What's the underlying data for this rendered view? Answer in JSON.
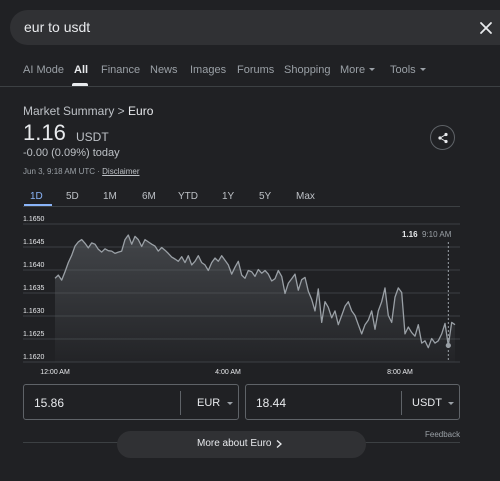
{
  "search": {
    "query": "eur to usdt"
  },
  "tabs": {
    "ai_mode": "AI Mode",
    "all": "All",
    "finance": "Finance",
    "news": "News",
    "images": "Images",
    "forums": "Forums",
    "shopping": "Shopping",
    "more": "More",
    "tools": "Tools"
  },
  "market": {
    "title_prefix": "Market Summary > ",
    "title_name": "Euro",
    "price": "1.16",
    "currency": "USDT",
    "change": "-0.00 (0.09%) today",
    "date": "Jun 3, 9:18 AM UTC · ",
    "disclaimer": "Disclaimer"
  },
  "ranges": [
    "1D",
    "5D",
    "1M",
    "6M",
    "YTD",
    "1Y",
    "5Y",
    "Max"
  ],
  "colors": {
    "accent": "#8ab4f8",
    "line": "#9aa0a6",
    "background": "#202124"
  },
  "chart_data": {
    "type": "area",
    "title": "",
    "xlabel": "",
    "ylabel": "",
    "ylim": [
      1.162,
      1.165
    ],
    "y_ticks": [
      "1.1650",
      "1.1645",
      "1.1640",
      "1.1635",
      "1.1630",
      "1.1625",
      "1.1620"
    ],
    "x_ticks": [
      "12:00 AM",
      "4:00 AM",
      "8:00 AM"
    ],
    "tooltip": {
      "value": "1.16",
      "time": "9:10 AM"
    },
    "series": [
      {
        "values": [
          1.16382,
          1.16389,
          1.16378,
          1.16396,
          1.16416,
          1.16432,
          1.16452,
          1.16461,
          1.16466,
          1.16458,
          1.16448,
          1.16459,
          1.16456,
          1.16445,
          1.16439,
          1.16446,
          1.16442,
          1.16441,
          1.16436,
          1.16439,
          1.16441,
          1.16466,
          1.16476,
          1.16456,
          1.16473,
          1.16466,
          1.16451,
          1.16466,
          1.16461,
          1.16456,
          1.16452,
          1.16441,
          1.16449,
          1.16443,
          1.16436,
          1.16428,
          1.16424,
          1.16419,
          1.16429,
          1.16416,
          1.16431,
          1.16411,
          1.16419,
          1.16431,
          1.16416,
          1.16411,
          1.16399,
          1.16416,
          1.16426,
          1.16419,
          1.16431,
          1.16421,
          1.16411,
          1.16391,
          1.16406,
          1.16419,
          1.16389,
          1.16382,
          1.16399,
          1.16396,
          1.16386,
          1.16401,
          1.16393,
          1.16399,
          1.16391,
          1.16376,
          1.16381,
          1.16399,
          1.16386,
          1.16349,
          1.16371,
          1.16381,
          1.16391,
          1.16356,
          1.16379,
          1.16384,
          1.16354,
          1.16336,
          1.16311,
          1.16359,
          1.16286,
          1.16331,
          1.16319,
          1.16296,
          1.16311,
          1.16281,
          1.16301,
          1.16321,
          1.16331,
          1.16311,
          1.16301,
          1.16281,
          1.16261,
          1.16281,
          1.16291,
          1.16311,
          1.16271,
          1.16311,
          1.16331,
          1.16361,
          1.16301,
          1.16286,
          1.16341,
          1.16361,
          1.16351,
          1.16261,
          1.16276,
          1.16264,
          1.16256,
          1.16281,
          1.16241,
          1.16246,
          1.16231,
          1.16251,
          1.16241,
          1.16246,
          1.16261,
          1.16284,
          1.16236,
          1.16286,
          1.16281
        ]
      }
    ]
  },
  "converter": {
    "from_value": "15.86",
    "from_unit": "EUR",
    "to_value": "18.44",
    "to_unit": "USDT"
  },
  "feedback": "Feedback",
  "more_button": "More about Euro"
}
